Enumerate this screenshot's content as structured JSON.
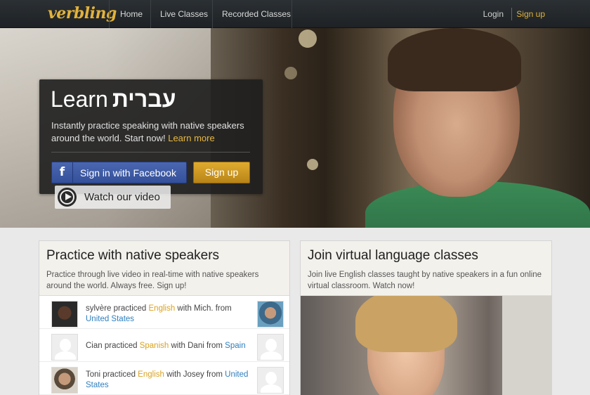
{
  "nav": {
    "logo": "verbling",
    "links": [
      "Home",
      "Live Classes",
      "Recorded Classes"
    ],
    "login": "Login",
    "signup": "Sign up"
  },
  "hero": {
    "learn": "Learn",
    "language": "עברית",
    "tagline": "Instantly practice speaking with native speakers around the world. Start now!",
    "learn_more": "Learn more",
    "facebook_button": "Sign in with Facebook",
    "signup_button": "Sign up",
    "watch_video": "Watch our video"
  },
  "practice": {
    "title": "Practice with native speakers",
    "description": "Practice through live video in real-time with native speakers around the world. Always free. Sign up!",
    "activity": [
      {
        "student": "sylvère",
        "verb": " practiced ",
        "language": "English",
        "with": " with Mich. from ",
        "place": "United States"
      },
      {
        "student": "Cian",
        "verb": " practiced ",
        "language": "Spanish",
        "with": " with Dani from ",
        "place": "Spain"
      },
      {
        "student": "Toni",
        "verb": " practiced ",
        "language": "English",
        "with": " with Josey from ",
        "place": "United States"
      }
    ]
  },
  "classes": {
    "title": "Join virtual language classes",
    "description": "Join live English classes taught by native speakers in a fun online virtual classroom. Watch now!"
  },
  "icons": {
    "facebook": "facebook-f-icon",
    "play": "play-circle-icon",
    "avatar_placeholder": "user-silhouette-icon"
  },
  "colors": {
    "accent": "#e2b23a",
    "link_blue": "#2f7fbf",
    "facebook_blue": "#3b5998",
    "nav_bg": "#23282b"
  }
}
